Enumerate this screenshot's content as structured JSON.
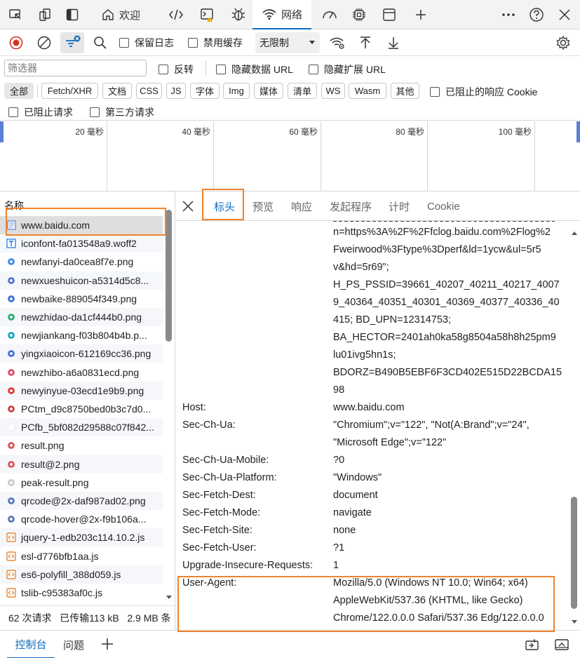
{
  "tabs": [
    {
      "label": "欢迎",
      "icon": "home-icon"
    },
    {
      "label": "",
      "icon": "code-icon"
    },
    {
      "label": "",
      "icon": "console-icon"
    },
    {
      "label": "",
      "icon": "bug-icon"
    },
    {
      "label": "网络",
      "icon": "wifi-icon"
    },
    {
      "label": "",
      "icon": "performance-icon"
    },
    {
      "label": "",
      "icon": "cpu-icon"
    },
    {
      "label": "",
      "icon": "window-icon"
    }
  ],
  "toolbar": {
    "preserve_log": "保留日志",
    "disable_cache": "禁用缓存",
    "throttle": "无限制"
  },
  "filters": {
    "placeholder": "筛选器",
    "invert": "反转",
    "hide_data_url": "隐藏数据 URL",
    "hide_ext_url": "隐藏扩展 URL",
    "types": [
      "全部",
      "Fetch/XHR",
      "文档",
      "CSS",
      "JS",
      "字体",
      "Img",
      "媒体",
      "清单",
      "WS",
      "Wasm",
      "其他"
    ],
    "blocked_cookies": "已阻止的响应 Cookie",
    "blocked_requests": "已阻止请求",
    "third_party": "第三方请求"
  },
  "timeline": {
    "ticks": [
      "20 毫秒",
      "40 毫秒",
      "60 毫秒",
      "80 毫秒",
      "100 毫秒"
    ]
  },
  "requests": {
    "header": "名称",
    "items": [
      {
        "name": "www.baidu.com",
        "icon": "document-icon",
        "color": "#5b7fd6"
      },
      {
        "name": "iconfont-fa013548a9.woff2",
        "icon": "font-icon",
        "color": "#1a73e8"
      },
      {
        "name": "newfanyi-da0cea8f7e.png",
        "icon": "image-icon",
        "color": "#3b8bf0"
      },
      {
        "name": "newxueshuicon-a5314d5c8...",
        "icon": "image-icon",
        "color": "#4a6fd8"
      },
      {
        "name": "newbaike-889054f349.png",
        "icon": "image-icon",
        "color": "#3a6ee8"
      },
      {
        "name": "newzhidao-da1cf444b0.png",
        "icon": "image-icon",
        "color": "#21b26f"
      },
      {
        "name": "newjiankang-f03b804b4b.p...",
        "icon": "image-icon",
        "color": "#12a9c9"
      },
      {
        "name": "yingxiaoicon-612169cc36.png",
        "icon": "image-icon",
        "color": "#3b6fe0"
      },
      {
        "name": "newzhibo-a6a0831ecd.png",
        "icon": "image-icon",
        "color": "#e8466b"
      },
      {
        "name": "newyinyue-03ecd1e9b9.png",
        "icon": "image-icon",
        "color": "#e5352e"
      },
      {
        "name": "PCtm_d9c8750bed0b3c7d0...",
        "icon": "image-icon",
        "color": "#d03c3c"
      },
      {
        "name": "PCfb_5bf082d29588c07f842...",
        "icon": "image-icon",
        "color": "#ffffff"
      },
      {
        "name": "result.png",
        "icon": "image-icon",
        "color": "#e05050"
      },
      {
        "name": "result@2.png",
        "icon": "image-icon",
        "color": "#e05050"
      },
      {
        "name": "peak-result.png",
        "icon": "image-icon",
        "color": "#cfcfcf"
      },
      {
        "name": "qrcode@2x-daf987ad02.png",
        "icon": "image-icon",
        "color": "#5577bb"
      },
      {
        "name": "qrcode-hover@2x-f9b106a...",
        "icon": "image-icon",
        "color": "#5577bb"
      },
      {
        "name": "jquery-1-edb203c114.10.2.js",
        "icon": "script-icon",
        "color": "#e8710a"
      },
      {
        "name": "esl-d776bfb1aa.js",
        "icon": "script-icon",
        "color": "#e8710a"
      },
      {
        "name": "es6-polyfill_388d059.js",
        "icon": "script-icon",
        "color": "#e8710a"
      },
      {
        "name": "tslib-c95383af0c.js",
        "icon": "script-icon",
        "color": "#e8710a"
      }
    ]
  },
  "status": "62 次请求   已传输113 kB   2.9 MB 条",
  "detail_tabs": [
    "标头",
    "预览",
    "响应",
    "发起程序",
    "计时",
    "Cookie"
  ],
  "headers_partial_value": [
    "n=https%3A%2F%2Ffclog.baidu.com%2Flog%2",
    "Fweirwood%3Ftype%3Dperf&ld=1ycw&ul=5r5",
    "v&hd=5r69\";",
    "H_PS_PSSID=39661_40207_40211_40217_4007",
    "9_40364_40351_40301_40369_40377_40336_40",
    "415; BD_UPN=12314753;",
    "BA_HECTOR=2401ah0ka58g8504a58h8h25pm9",
    "lu01ivg5hn1s;",
    "BDORZ=B490B5EBF6F3CD402E515D22BCDA15",
    "98"
  ],
  "headers": [
    {
      "name": "Host:",
      "value": [
        "www.baidu.com"
      ]
    },
    {
      "name": "Sec-Ch-Ua:",
      "value": [
        "\"Chromium\";v=\"122\", \"Not(A:Brand\";v=\"24\",",
        "\"Microsoft Edge\";v=\"122\""
      ]
    },
    {
      "name": "Sec-Ch-Ua-Mobile:",
      "value": [
        "?0"
      ]
    },
    {
      "name": "Sec-Ch-Ua-Platform:",
      "value": [
        "\"Windows\""
      ]
    },
    {
      "name": "Sec-Fetch-Dest:",
      "value": [
        "document"
      ]
    },
    {
      "name": "Sec-Fetch-Mode:",
      "value": [
        "navigate"
      ]
    },
    {
      "name": "Sec-Fetch-Site:",
      "value": [
        "none"
      ]
    },
    {
      "name": "Sec-Fetch-User:",
      "value": [
        "?1"
      ]
    },
    {
      "name": "Upgrade-Insecure-Requests:",
      "value": [
        "1"
      ]
    },
    {
      "name": "User-Agent:",
      "value": [
        "Mozilla/5.0 (Windows NT 10.0; Win64; x64)",
        "AppleWebKit/537.36 (KHTML, like Gecko)",
        "Chrome/122.0.0.0 Safari/537.36 Edg/122.0.0.0"
      ]
    }
  ],
  "bottom": {
    "console": "控制台",
    "issues": "问题"
  },
  "colors": {
    "accent": "#0f6cbd",
    "highlight": "#f0822e",
    "record": "#d93025"
  }
}
